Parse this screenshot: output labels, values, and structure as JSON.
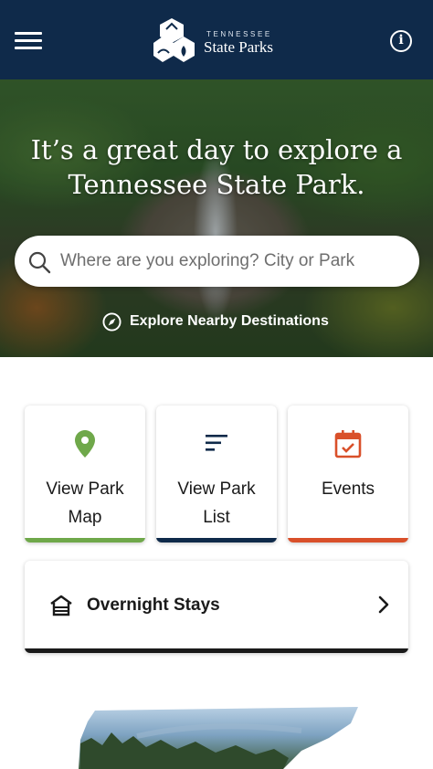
{
  "header": {
    "menu_icon": "hamburger-menu-icon",
    "logo_top": "TENNESSEE",
    "logo_main": "State Parks",
    "info_icon": "info-icon",
    "info_glyph": "i",
    "background": "#0f2a4a"
  },
  "hero": {
    "title_line1": "It’s a great day to explore a",
    "title_line2": "Tennessee State Park.",
    "search": {
      "placeholder": "Where are you exploring? City or Park",
      "icon": "search-icon"
    },
    "explore_nearby": {
      "label": "Explore Nearby Destinations",
      "icon": "compass-icon"
    }
  },
  "tiles": [
    {
      "line1": "View Park",
      "line2": "Map",
      "icon": "map-pin-icon",
      "accent": "#6fa84a"
    },
    {
      "line1": "View Park",
      "line2": "List",
      "icon": "list-icon",
      "accent": "#0f2a4a"
    },
    {
      "line1": "Events",
      "line2": "",
      "icon": "calendar-icon",
      "accent": "#d9502a"
    }
  ],
  "overnight": {
    "label": "Overnight Stays",
    "icon": "cabin-icon",
    "chevron": "chevron-right-icon",
    "accent": "#1a1a1a"
  }
}
